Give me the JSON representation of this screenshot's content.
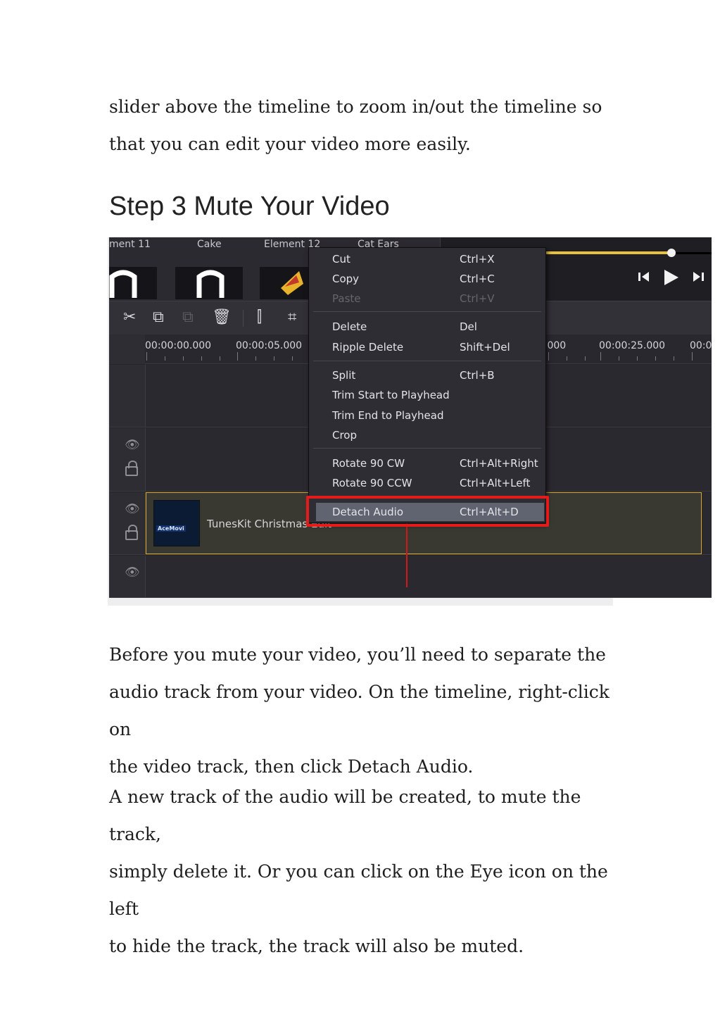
{
  "intro": {
    "line1": "slider above the timeline to zoom in/out the timeline so",
    "line2": "that you can edit your video more easily."
  },
  "heading": "Step 3 Mute Your Video",
  "screenshot": {
    "library_labels": [
      "ment 11",
      "Cake",
      "Element 12",
      "Cat Ears"
    ],
    "timecodes": [
      "00:00:00.000",
      "00:00:05.000",
      ".000",
      "00:00:25.000",
      "00:0"
    ],
    "clip_title": "TunesKit Christmas Edit",
    "clip_thumb_text": "AceMovi",
    "context_menu": {
      "items": [
        {
          "label": "Cut",
          "shortcut": "Ctrl+X"
        },
        {
          "label": "Copy",
          "shortcut": "Ctrl+C"
        },
        {
          "label": "Paste",
          "shortcut": "Ctrl+V"
        },
        {
          "label": "Delete",
          "shortcut": "Del"
        },
        {
          "label": "Ripple Delete",
          "shortcut": "Shift+Del"
        },
        {
          "label": "Split",
          "shortcut": "Ctrl+B"
        },
        {
          "label": "Trim Start to Playhead",
          "shortcut": ""
        },
        {
          "label": "Trim End to Playhead",
          "shortcut": ""
        },
        {
          "label": "Crop",
          "shortcut": ""
        },
        {
          "label": "Rotate 90 CW",
          "shortcut": "Ctrl+Alt+Right"
        },
        {
          "label": "Rotate 90 CCW",
          "shortcut": "Ctrl+Alt+Left"
        },
        {
          "label": "Detach Audio",
          "shortcut": "Ctrl+Alt+D"
        }
      ]
    },
    "colors": {
      "highlight": "#e41b1b",
      "zoom_accent": "#e9c23b",
      "clip_border": "#d8a927"
    }
  },
  "body": {
    "p1_line1": "Before you mute your video, you’ll need to separate the",
    "p1_line2": "audio track from your video. On the timeline, right-click on",
    "p1_line3": "the video track, then click Detach Audio.",
    "p2_line1": "A new track of the audio will be created, to mute the track,",
    "p2_line2": "simply delete it. Or you can click on the Eye icon on the left",
    "p2_line3": "to hide the track, the track will also be muted."
  }
}
